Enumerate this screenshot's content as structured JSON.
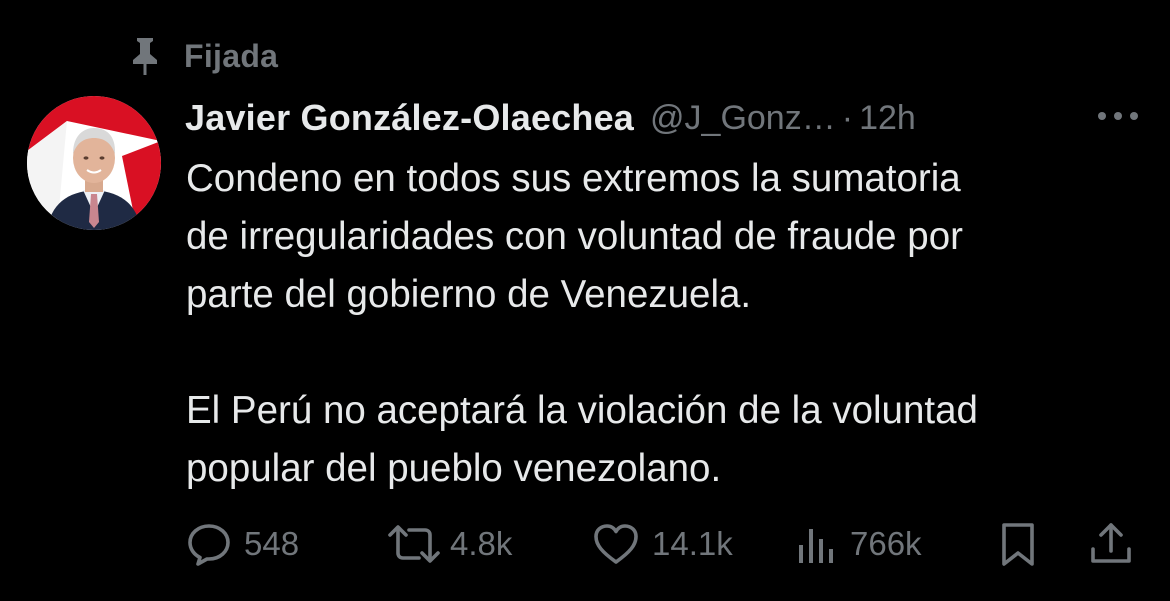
{
  "pinned": {
    "label": "Fijada",
    "icon": "pin-icon"
  },
  "author": {
    "display_name": "Javier González-Olaechea",
    "handle": "@J_Gonz…",
    "separator": "·",
    "time": "12h",
    "avatar_icon": "avatar"
  },
  "tweet": {
    "paragraphs": [
      [
        "Condeno en todos sus extremos la sumatoria",
        "de irregularidades con voluntad de fraude por",
        "parte del gobierno de Venezuela."
      ],
      [
        "El Perú no aceptará la violación de la voluntad",
        "popular del pueblo venezolano."
      ]
    ],
    "line_1": "Condeno en todos sus extremos la sumatoria",
    "line_2": "de irregularidades con voluntad de fraude por",
    "line_3": "parte del gobierno de Venezuela.",
    "line_4": "El Perú no aceptará la violación de la voluntad",
    "line_5": "popular del pueblo venezolano."
  },
  "actions": {
    "replies": {
      "count": "548",
      "icon": "reply-icon"
    },
    "reposts": {
      "count": "4.8k",
      "icon": "repost-icon"
    },
    "likes": {
      "count": "14.1k",
      "icon": "heart-icon"
    },
    "views": {
      "count": "766k",
      "icon": "views-icon"
    },
    "bookmark": {
      "icon": "bookmark-icon"
    },
    "share": {
      "icon": "share-icon"
    }
  },
  "colors": {
    "background": "#000000",
    "text_primary": "#e7e9ea",
    "text_secondary": "#71767b",
    "avatar_flag_red": "#d91023"
  }
}
